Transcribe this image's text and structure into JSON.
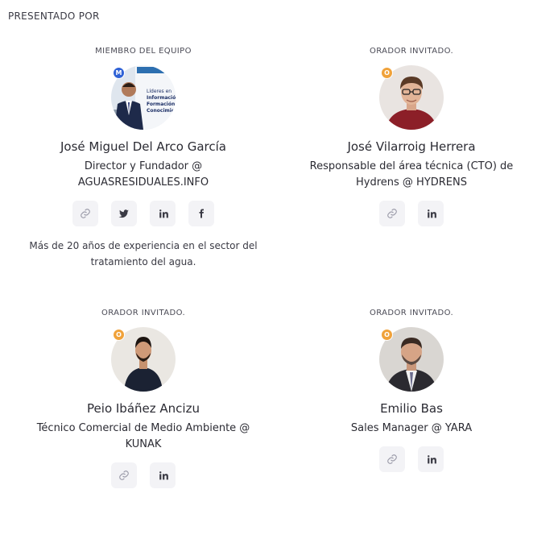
{
  "section": {
    "title": "PRESENTADO POR"
  },
  "speakers": [
    {
      "role": "MIEMBRO DEL EQUIPO",
      "badge": "M",
      "name": "José Miguel Del Arco García",
      "title": "Director y Fundador @ AGUASRESIDUALES.INFO",
      "socials": [
        "link-icon",
        "twitter-icon",
        "linkedin-icon",
        "facebook-icon"
      ],
      "bio": "Más de 20 años de experiencia en el sector del tratamiento del agua.",
      "avatar_poster_text": "Líderes en Información, Formación y Conocimiento"
    },
    {
      "role": "ORADOR INVITADO.",
      "badge": "O",
      "name": "José Vilarroig Herrera",
      "title": "Responsable del área técnica (CTO) de Hydrens @ HYDRENS",
      "socials": [
        "link-icon",
        "linkedin-icon"
      ]
    },
    {
      "role": "ORADOR INVITADO.",
      "badge": "O",
      "name": "Peio Ibáñez Ancizu",
      "title": "Técnico Comercial de Medio Ambiente @ KUNAK",
      "socials": [
        "link-icon",
        "linkedin-icon"
      ]
    },
    {
      "role": "ORADOR INVITADO.",
      "badge": "O",
      "name": "Emilio Bas",
      "title": "Sales Manager @ YARA",
      "socials": [
        "link-icon",
        "linkedin-icon"
      ]
    }
  ],
  "colors": {
    "badge_member": "#2f62d6",
    "badge_guest": "#f0a23a",
    "icon_bg": "#f3f3f6"
  }
}
